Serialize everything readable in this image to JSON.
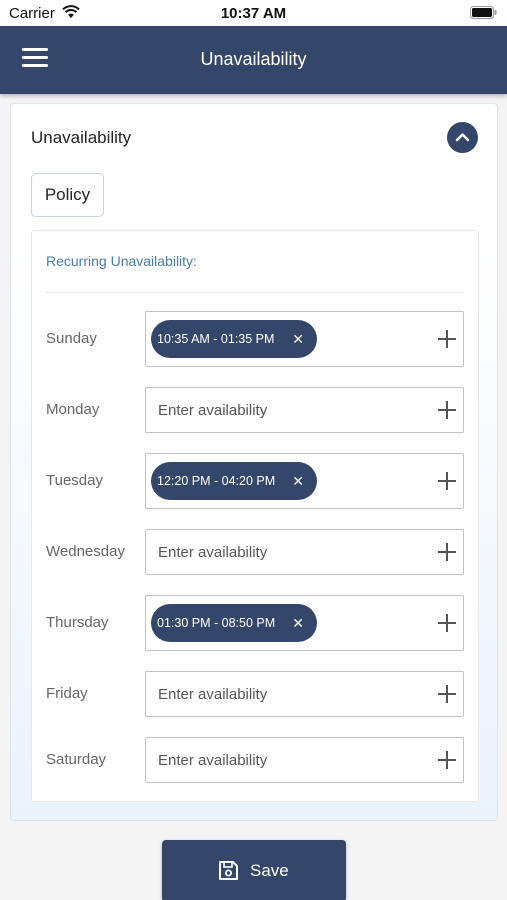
{
  "status_bar": {
    "carrier": "Carrier",
    "time": "10:37 AM",
    "wifi_icon": "wifi-icon",
    "battery_icon": "battery-icon"
  },
  "header": {
    "title": "Unavailability",
    "menu_icon": "menu-icon"
  },
  "card": {
    "title": "Unavailability",
    "collapse_icon": "chevron-up-icon",
    "policy_tab": "Policy",
    "section_heading": "Recurring Unavailability:",
    "days": [
      {
        "label": "Sunday",
        "chip": "10:35 AM - 01:35 PM",
        "placeholder": ""
      },
      {
        "label": "Monday",
        "chip": "",
        "placeholder": "Enter availability"
      },
      {
        "label": "Tuesday",
        "chip": "12:20 PM - 04:20 PM",
        "placeholder": ""
      },
      {
        "label": "Wednesday",
        "chip": "",
        "placeholder": "Enter availability"
      },
      {
        "label": "Thursday",
        "chip": "01:30 PM - 08:50 PM",
        "placeholder": ""
      },
      {
        "label": "Friday",
        "chip": "",
        "placeholder": "Enter availability"
      },
      {
        "label": "Saturday",
        "chip": "",
        "placeholder": "Enter availability"
      }
    ],
    "chip_close": "✕",
    "add_icon": "plus-icon"
  },
  "save_button": {
    "label": "Save",
    "icon": "save-icon"
  },
  "colors": {
    "primary": "#34476a",
    "accent_text": "#4a7bb0",
    "background": "#f4f4f5"
  }
}
